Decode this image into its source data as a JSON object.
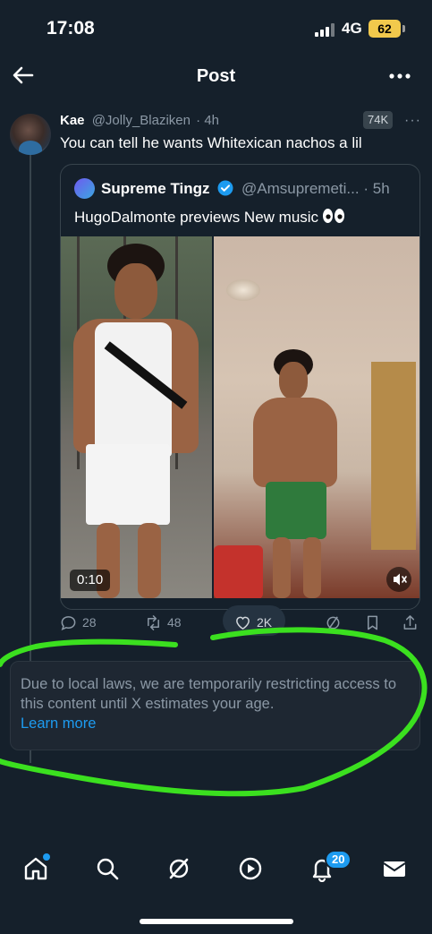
{
  "status_bar": {
    "time": "17:08",
    "network": "4G",
    "battery": "62"
  },
  "header": {
    "title": "Post"
  },
  "tweet": {
    "author_name": "Kae",
    "author_handle": "@Jolly_Blaziken",
    "time": "4h",
    "views_badge": "74K",
    "text": "You can tell he wants Whitexican nachos a lil"
  },
  "quote": {
    "author_name": "Supreme Tingz",
    "author_handle": "@Amsupremeti...",
    "time": "5h",
    "text": "HugoDalmonte previews New music",
    "video_time": "0:10"
  },
  "actions": {
    "replies": "28",
    "reposts": "48",
    "likes": "2K"
  },
  "notice": {
    "text": "Due to local laws, we are temporarily restricting access to this content until X estimates your age.",
    "link": "Learn more"
  },
  "bottom_nav": {
    "notifications_count": "20"
  },
  "colors": {
    "background": "#15202b",
    "accent": "#1d9bf0",
    "muted": "#8b98a5",
    "battery": "#f2c94c",
    "scribble": "#3be01f"
  }
}
